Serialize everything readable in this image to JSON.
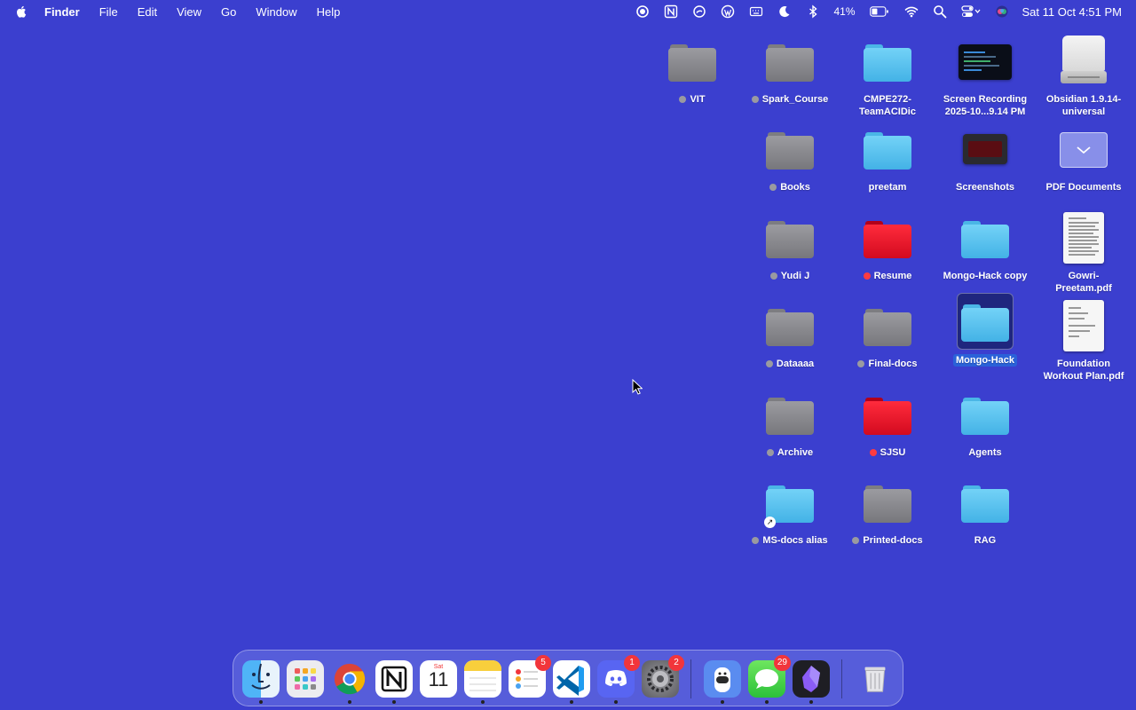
{
  "menubar": {
    "app_name": "Finder",
    "menus": [
      "File",
      "Edit",
      "View",
      "Go",
      "Window",
      "Help"
    ],
    "status_icons": [
      "record-icon",
      "notion-icon",
      "sync-icon",
      "wordpress-icon",
      "keyboard-icon",
      "focus-moon-icon",
      "bluetooth-icon"
    ],
    "battery_percent": "41%",
    "clock": "Sat 11 Oct  4:51 PM"
  },
  "desktop": {
    "items": [
      {
        "label": "VIT",
        "kind": "folder",
        "color": "grey",
        "tag": "grey"
      },
      {
        "label": "Spark_Course",
        "kind": "folder",
        "color": "grey",
        "tag": "grey"
      },
      {
        "label": "CMPE272-",
        "label2": "TeamACIDic",
        "kind": "folder",
        "color": "blue",
        "tag": ""
      },
      {
        "label": "Screen Recording",
        "label2": "2025-10...9.14 PM",
        "kind": "video",
        "tag": ""
      },
      {
        "label": "Obsidian 1.9.14-",
        "label2": "universal",
        "kind": "disk",
        "tag": ""
      },
      {
        "label": "Books",
        "kind": "folder",
        "color": "grey",
        "tag": "grey"
      },
      {
        "label": "preetam",
        "kind": "folder",
        "color": "blue",
        "tag": ""
      },
      {
        "label": "Screenshots",
        "kind": "screenshot",
        "tag": ""
      },
      {
        "label": "PDF Documents",
        "kind": "pdfdocs",
        "tag": ""
      },
      {
        "label": "Yudi J",
        "kind": "folder",
        "color": "grey",
        "tag": "grey"
      },
      {
        "label": "Resume",
        "kind": "folder",
        "color": "red",
        "tag": "red"
      },
      {
        "label": "Mongo-Hack copy",
        "kind": "folder",
        "color": "blue",
        "tag": ""
      },
      {
        "label": "Gowri-",
        "label2": "Preetam.pdf",
        "kind": "file",
        "tag": ""
      },
      {
        "label": "Dataaaa",
        "kind": "folder",
        "color": "grey",
        "tag": "grey"
      },
      {
        "label": "Final-docs",
        "kind": "folder",
        "color": "grey",
        "tag": "grey"
      },
      {
        "label": "Mongo-Hack",
        "kind": "folder",
        "color": "blue",
        "tag": "",
        "selected": true
      },
      {
        "label": "Foundation",
        "label2": "Workout Plan.pdf",
        "kind": "file",
        "tag": ""
      },
      {
        "label": "Archive",
        "kind": "folder",
        "color": "grey",
        "tag": "grey"
      },
      {
        "label": "SJSU",
        "kind": "folder",
        "color": "red",
        "tag": "red"
      },
      {
        "label": "Agents",
        "kind": "folder",
        "color": "blue",
        "tag": ""
      },
      {
        "label": "MS-docs alias",
        "kind": "folder",
        "color": "blue",
        "tag": "grey",
        "alias": true
      },
      {
        "label": "Printed-docs",
        "kind": "folder",
        "color": "grey",
        "tag": "grey"
      },
      {
        "label": "RAG",
        "kind": "folder",
        "color": "blue",
        "tag": ""
      }
    ]
  },
  "dock": {
    "calendar_month": "Sat",
    "calendar_day": "11",
    "apps": [
      {
        "name": "Finder",
        "icon": "finder-icon",
        "badge": ""
      },
      {
        "name": "Launchpad",
        "icon": "launchpad-icon",
        "badge": ""
      },
      {
        "name": "Google Chrome",
        "icon": "chrome-icon",
        "badge": ""
      },
      {
        "name": "Notion",
        "icon": "notion-icon",
        "badge": ""
      },
      {
        "name": "Calendar",
        "icon": "calendar-icon",
        "badge": ""
      },
      {
        "name": "Notes",
        "icon": "notes-icon",
        "badge": ""
      },
      {
        "name": "Reminders",
        "icon": "reminders-icon",
        "badge": "5"
      },
      {
        "name": "Visual Studio Code",
        "icon": "vscode-icon",
        "badge": ""
      },
      {
        "name": "Discord",
        "icon": "discord-icon",
        "badge": "1"
      },
      {
        "name": "System Settings",
        "icon": "settings-icon",
        "badge": "2"
      },
      {
        "name": "Ollama",
        "icon": "ollama-icon",
        "badge": ""
      },
      {
        "name": "Messages",
        "icon": "messages-icon",
        "badge": "29"
      },
      {
        "name": "Obsidian",
        "icon": "obsidian-icon",
        "badge": ""
      },
      {
        "name": "Trash",
        "icon": "trash-icon",
        "badge": ""
      }
    ]
  },
  "colors": {
    "desktop_bg": "#3b3fcf",
    "folder_blue": "#5cc6f2",
    "folder_grey": "#8b8b90",
    "folder_red": "#e8182b",
    "tag_red": "#ff3b41",
    "tag_grey": "#9a9aa0",
    "badge_red": "#f2353b",
    "selection_blue": "#2a62d9"
  }
}
